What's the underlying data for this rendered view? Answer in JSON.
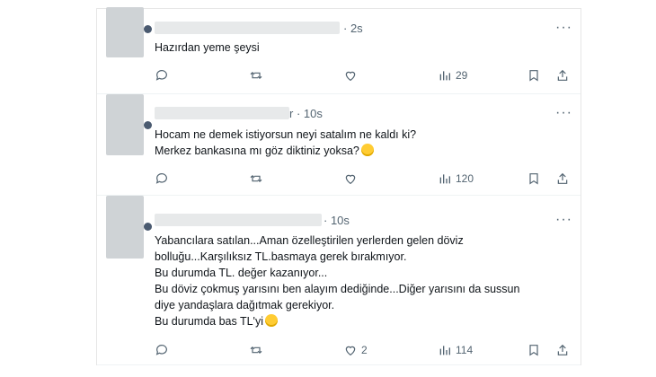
{
  "tweets": [
    {
      "time": "2s",
      "text": "Hazırdan yeme şeysi",
      "views": "29",
      "likes": "",
      "emoji": ""
    },
    {
      "time": "10s",
      "text": "Hocam ne demek istiyorsun neyi satalım ne kaldı ki?\nMerkez bankasına mı göz diktiniz yoksa?",
      "views": "120",
      "likes": "",
      "emoji": "🤣"
    },
    {
      "time": "10s",
      "text": "Yabancılara satılan...Aman özelleştirilen yerlerden gelen döviz\nbolluğu...Karşılıksız TL.basmaya gerek bırakmıyor.\nBu durumda TL. değer kazanıyor...\nBu döviz çokmuş yarısını ben alayım dediğinde...Diğer yarısını da sussun\ndiye yandaşlara dağıtmak gerekiyor.\nBu durumda bas TL'yi",
      "views": "114",
      "likes": "2",
      "emoji": "🤣"
    }
  ],
  "icons": {
    "more": "more-dots-icon",
    "reply": "reply-icon",
    "retweet": "retweet-icon",
    "like": "heart-icon",
    "views": "views-bar-icon",
    "bookmark": "bookmark-icon",
    "share": "share-icon"
  },
  "colors": {
    "text": "#0f1419",
    "muted": "#536471",
    "divider": "#eff3f4"
  }
}
